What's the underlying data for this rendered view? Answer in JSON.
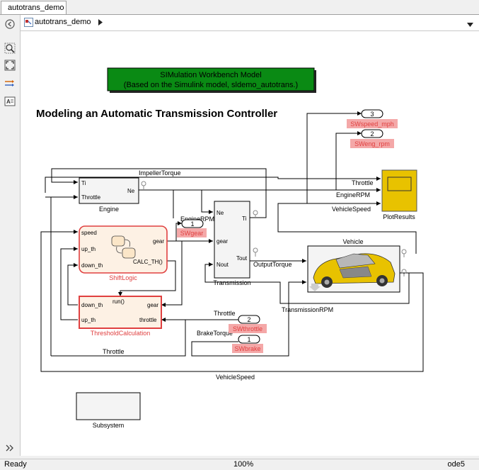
{
  "window": {
    "tab_label": "autotrans_demo",
    "breadcrumb_label": "autotrans_demo"
  },
  "toolbar_icons": [
    "back-icon",
    "zoom-icon",
    "fit-to-view-icon",
    "signal-routing-icon",
    "annotation-icon",
    "more-icon"
  ],
  "model": {
    "banner_line1": "SIMulation Workbench Model",
    "banner_line2": "(Based on the Simulink model, sldemo_autotrans.)",
    "heading": "Modeling an Automatic Transmission Controller",
    "blocks": {
      "engine": {
        "name": "Engine",
        "port_ti": "Ti",
        "port_throttle": "Throttle",
        "port_ne": "Ne"
      },
      "transmission": {
        "name": "Transmission",
        "port_ne": "Ne",
        "port_gear": "gear",
        "port_nout": "Nout",
        "port_ti": "Ti",
        "port_tout": "Tout"
      },
      "shiftlogic": {
        "name": "ShiftLogic",
        "port_speed": "speed",
        "port_up": "up_th",
        "port_down": "down_th",
        "port_gear": "gear",
        "calc": "CALC_TH()"
      },
      "threshold": {
        "name": "ThresholdCalculation",
        "port_down": "down_th",
        "port_up": "up_th",
        "run": "run()",
        "port_gear": "gear",
        "port_throttle": "throttle"
      },
      "vehicle": {
        "name": "Vehicle"
      },
      "plot": {
        "name": "PlotResults"
      },
      "subsystem": {
        "name": "Subsystem"
      }
    },
    "ports": {
      "out3": {
        "num": "3",
        "label": "SWspeed_mph"
      },
      "out2": {
        "num": "2",
        "label": "SWeng_rpm"
      },
      "out1": {
        "num": "1",
        "label": "SWgear"
      },
      "in2": {
        "num": "2",
        "label": "SWthrottle"
      },
      "in1": {
        "num": "1",
        "label": "SWbrake"
      }
    },
    "signals": {
      "impeller_torque": "ImpellerTorque",
      "engine_rpm_top": "EngineRPM",
      "engine_rpm_mid": "EngineRPM",
      "throttle_plot": "Throttle",
      "vehicle_speed_plot": "VehicleSpeed",
      "output_torque": "OutputTorque",
      "transmission_rpm": "TransmissionRPM",
      "throttle_in": "Throttle",
      "brake_torque": "BrakeTorque",
      "throttle_bottom": "Throttle",
      "vehicle_speed_bottom": "VehicleSpeed"
    }
  },
  "status": {
    "state": "Ready",
    "zoom": "100%",
    "solver": "ode5"
  },
  "colors": {
    "banner_fill": "#0a8a14",
    "selection_red": "#e04040",
    "port_label_bg": "#f4a8a8",
    "scope_fill": "#e8c200"
  }
}
